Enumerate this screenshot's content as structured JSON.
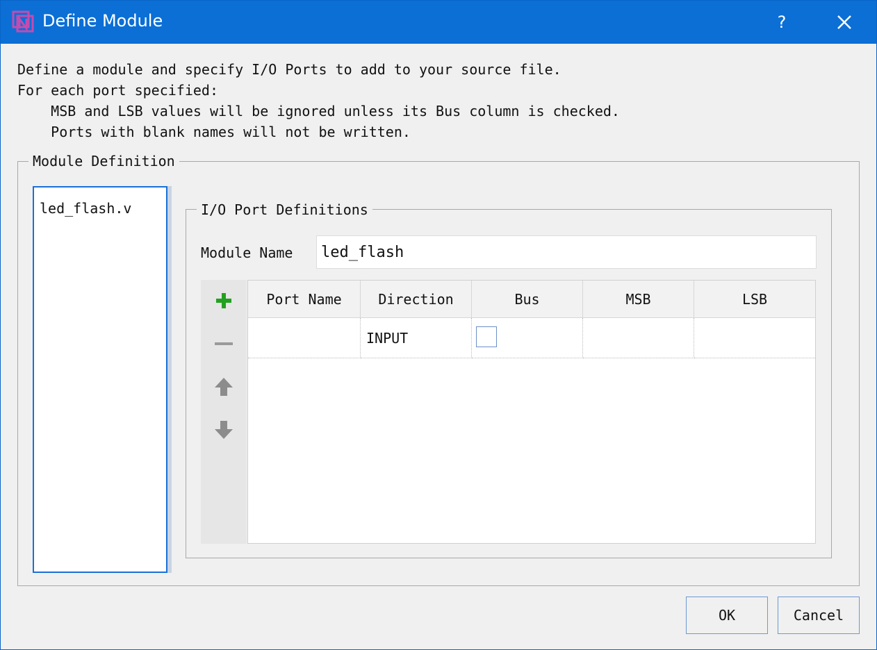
{
  "window": {
    "title": "Define Module",
    "help_label": "?",
    "accent_color": "#0b6fd6"
  },
  "description": {
    "line1": "Define a module and specify I/O Ports to add to your source file.",
    "line2": "For each port specified:",
    "line3": "    MSB and LSB values will be ignored unless its Bus column is checked.",
    "line4": "    Ports with blank names will not be written."
  },
  "module_definition": {
    "group_label": "Module Definition",
    "files": [
      "led_flash.v"
    ]
  },
  "io_ports": {
    "group_label": "I/O Port Definitions",
    "module_name_label": "Module Name",
    "module_name_value": "led_flash",
    "toolbar_icons": [
      "add-icon",
      "remove-icon",
      "move-up-icon",
      "move-down-icon"
    ],
    "columns": [
      "Port Name",
      "Direction",
      "Bus",
      "MSB",
      "LSB"
    ],
    "rows": [
      {
        "port_name": "",
        "direction": "INPUT",
        "bus": false,
        "msb": "",
        "lsb": ""
      }
    ]
  },
  "buttons": {
    "ok": "OK",
    "cancel": "Cancel"
  }
}
